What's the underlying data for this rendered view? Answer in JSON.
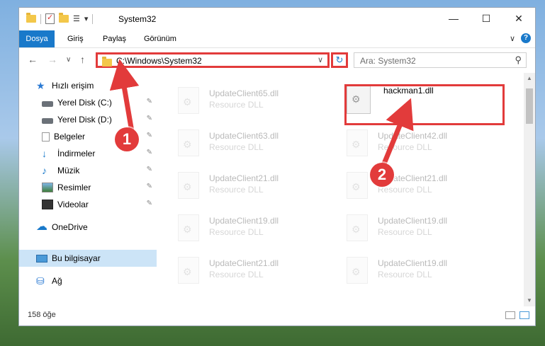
{
  "window": {
    "title": "System32",
    "qat_dropdown": "▾",
    "buttons": {
      "minimize": "—",
      "maximize": "☐",
      "close": "✕"
    }
  },
  "ribbon": {
    "tabs": [
      "Dosya",
      "Giriş",
      "Paylaş",
      "Görünüm"
    ],
    "collapse": "∨",
    "help": "?"
  },
  "nav": {
    "back": "←",
    "forward": "→",
    "recent": "∨",
    "up": "↑",
    "address": "C:\\Windows\\System32",
    "address_dropdown": "∨",
    "refresh": "↻",
    "search_placeholder": "Ara: System32",
    "search_icon": "⚲"
  },
  "sidebar": {
    "quick_access": "Hızlı erişim",
    "items": [
      {
        "label": "Yerel Disk (C:)",
        "icon": "drive-icon"
      },
      {
        "label": "Yerel Disk (D:)",
        "icon": "drive-icon"
      },
      {
        "label": "Belgeler",
        "icon": "documents-icon"
      },
      {
        "label": "İndirmeler",
        "icon": "downloads-icon"
      },
      {
        "label": "Müzik",
        "icon": "music-icon"
      },
      {
        "label": "Resimler",
        "icon": "pictures-icon"
      },
      {
        "label": "Videolar",
        "icon": "videos-icon"
      }
    ],
    "pin": "📌",
    "onedrive": "OneDrive",
    "this_pc": "Bu bilgisayar",
    "network": "Ağ"
  },
  "files": {
    "left_column": [
      {
        "name": "UpdateClient65.dll",
        "type": "Resource DLL"
      },
      {
        "name": "UpdateClient63.dll",
        "type": "Resource DLL"
      },
      {
        "name": "UpdateClient21.dll",
        "type": "Resource DLL"
      },
      {
        "name": "UpdateClient19.dll",
        "type": "Resource DLL"
      },
      {
        "name": "UpdateClient21.dll",
        "type": "Resource DLL"
      }
    ],
    "right_column": [
      {
        "name": "hackman1.dll",
        "type": ""
      },
      {
        "name": "UpdateClient42.dll",
        "type": "Resource DLL"
      },
      {
        "name": "UpdateClient21.dll",
        "type": "Resource DLL"
      },
      {
        "name": "UpdateClient19.dll",
        "type": "Resource DLL"
      },
      {
        "name": "UpdateClient19.dll",
        "type": "Resource DLL"
      }
    ]
  },
  "status": {
    "item_count": "158 öğe"
  },
  "annotations": {
    "badge1": "1",
    "badge2": "2",
    "color": "#e23b3b"
  }
}
